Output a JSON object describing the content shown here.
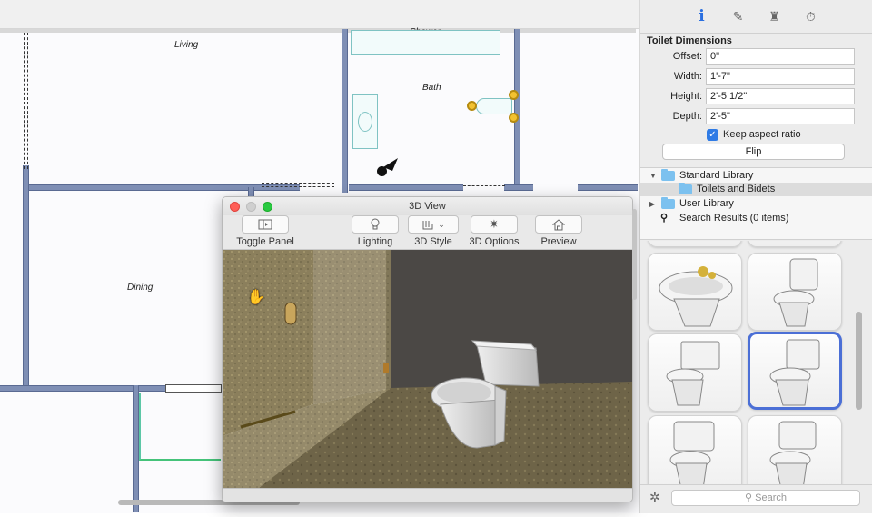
{
  "plan": {
    "rooms": {
      "living": "Living",
      "shower": "Shower",
      "bath": "Bath",
      "dining": "Dining"
    }
  },
  "view3d": {
    "title": "3D View",
    "toolbar": {
      "toggle_panel": "Toggle Panel",
      "lighting": "Lighting",
      "style": "3D Style",
      "options": "3D Options",
      "preview": "Preview"
    }
  },
  "panel": {
    "tabs": [
      {
        "name": "info-icon",
        "glyph": "i"
      },
      {
        "name": "paint-icon",
        "glyph": "✎"
      },
      {
        "name": "furniture-icon",
        "glyph": "♜"
      },
      {
        "name": "timer-icon",
        "glyph": "⏱"
      }
    ],
    "section_title": "Toilet Dimensions",
    "fields": {
      "offset_label": "Offset:",
      "offset_value": "0\"",
      "width_label": "Width:",
      "width_value": "1'-7\"",
      "height_label": "Height:",
      "height_value": "2'-5 1/2\"",
      "depth_label": "Depth:",
      "depth_value": "2'-5\""
    },
    "keep_aspect": "Keep aspect ratio",
    "flip": "Flip",
    "library": {
      "standard": "Standard Library",
      "toilets": "Toilets and Bidets",
      "user": "User Library",
      "search_results": "Search Results (0 items)"
    },
    "search_placeholder": "Search"
  }
}
